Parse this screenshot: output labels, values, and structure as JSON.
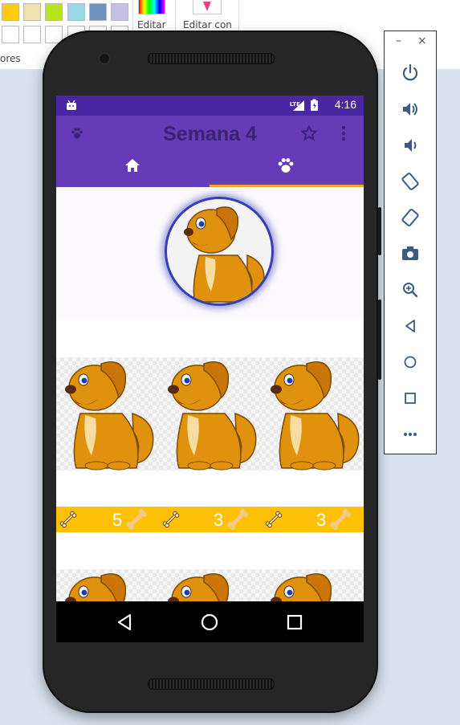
{
  "ribbon": {
    "colors_label": "ores",
    "edit_colors_label": "Editar",
    "edit_with_label": "Editar con",
    "swatches_top": [
      "#ffc90e",
      "#efe4b0",
      "#b5e61d",
      "#99d9ea",
      "#7092be",
      "#c8bfe7"
    ],
    "swatches_bottom": [
      "#ffffff",
      "#ffffff",
      "#ffffff",
      "#ffffff",
      "#ffffff",
      "#ffffff"
    ]
  },
  "status_bar": {
    "time": "4:16",
    "network": "LTE",
    "color": "#4a27a2"
  },
  "app_bar": {
    "title": "Semana 4",
    "leading_icon": "paw-icon",
    "actions": [
      "star-icon",
      "overflow-menu-icon"
    ],
    "color": "#673ab7",
    "title_color": "#3a2371"
  },
  "tabs": [
    {
      "icon": "home-icon",
      "selected": false
    },
    {
      "icon": "paw-icon",
      "selected": true
    }
  ],
  "tab_indicator_color": "#f4a52a",
  "pets": [
    {
      "likes": "5",
      "icon": "bone-icon"
    },
    {
      "likes": "3",
      "icon": "bone-icon"
    },
    {
      "likes": "3",
      "icon": "bone-icon"
    }
  ],
  "likes_bar_color": "#ffc107",
  "nav_bar": {
    "buttons": [
      "back-icon",
      "home-circle-icon",
      "recents-icon"
    ]
  },
  "emulator_panel": {
    "window_controls": [
      "minimize-icon",
      "close-icon"
    ],
    "buttons": [
      "power-icon",
      "volume-up-icon",
      "volume-down-icon",
      "rotate-left-icon",
      "rotate-right-icon",
      "camera-icon",
      "zoom-icon",
      "back-icon",
      "home-icon",
      "overview-icon",
      "more-icon"
    ]
  }
}
